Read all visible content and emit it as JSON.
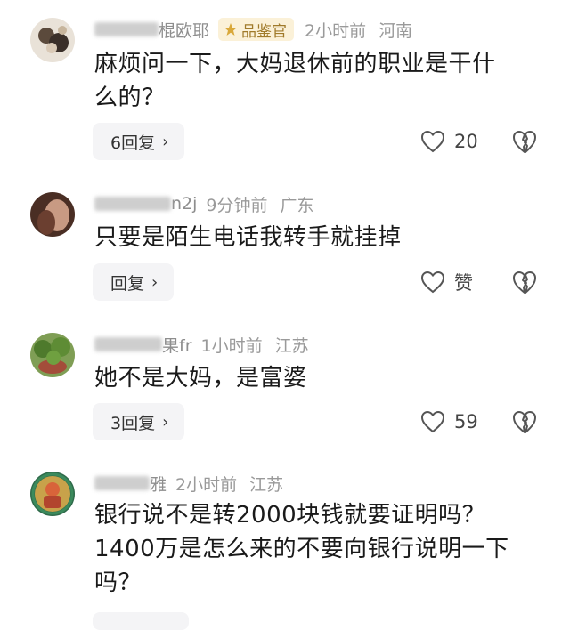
{
  "comments": [
    {
      "username_visible": "棍欧耶",
      "badge": "品鉴官",
      "time": "2小时前",
      "location": "河南",
      "text_line1": "麻烦问一下，大妈退休前的职业是干什",
      "text_line2": "么的？",
      "reply_label": "6回复",
      "like_count": "20"
    },
    {
      "username_visible": "n2j",
      "time": "9分钟前",
      "location": "广东",
      "text_line1": "只要是陌生电话我转手就挂掉",
      "reply_label": "回复",
      "like_count": "赞"
    },
    {
      "username_visible": "果fr",
      "time": "1小时前",
      "location": "江苏",
      "text_line1": "她不是大妈，是富婆",
      "reply_label": "3回复",
      "like_count": "59"
    },
    {
      "username_visible": "雅",
      "time": "2小时前",
      "location": "江苏",
      "text_line1": "银行说不是转2000块钱就要证明吗？",
      "text_line2": "1400万是怎么来的不要向银行说明一下",
      "text_line3": "吗？"
    }
  ],
  "icons": {
    "reply_chevron": "chevron-right-icon",
    "like": "heart-outline-icon",
    "dislike": "broken-heart-icon",
    "badge": "gold-medal-icon"
  },
  "colors": {
    "text": "#1a1a1a",
    "meta": "#9a9a9a",
    "badge_bg": "#fbf1d8",
    "badge_text": "#a07a2a",
    "reply_bg": "#f4f4f6"
  }
}
